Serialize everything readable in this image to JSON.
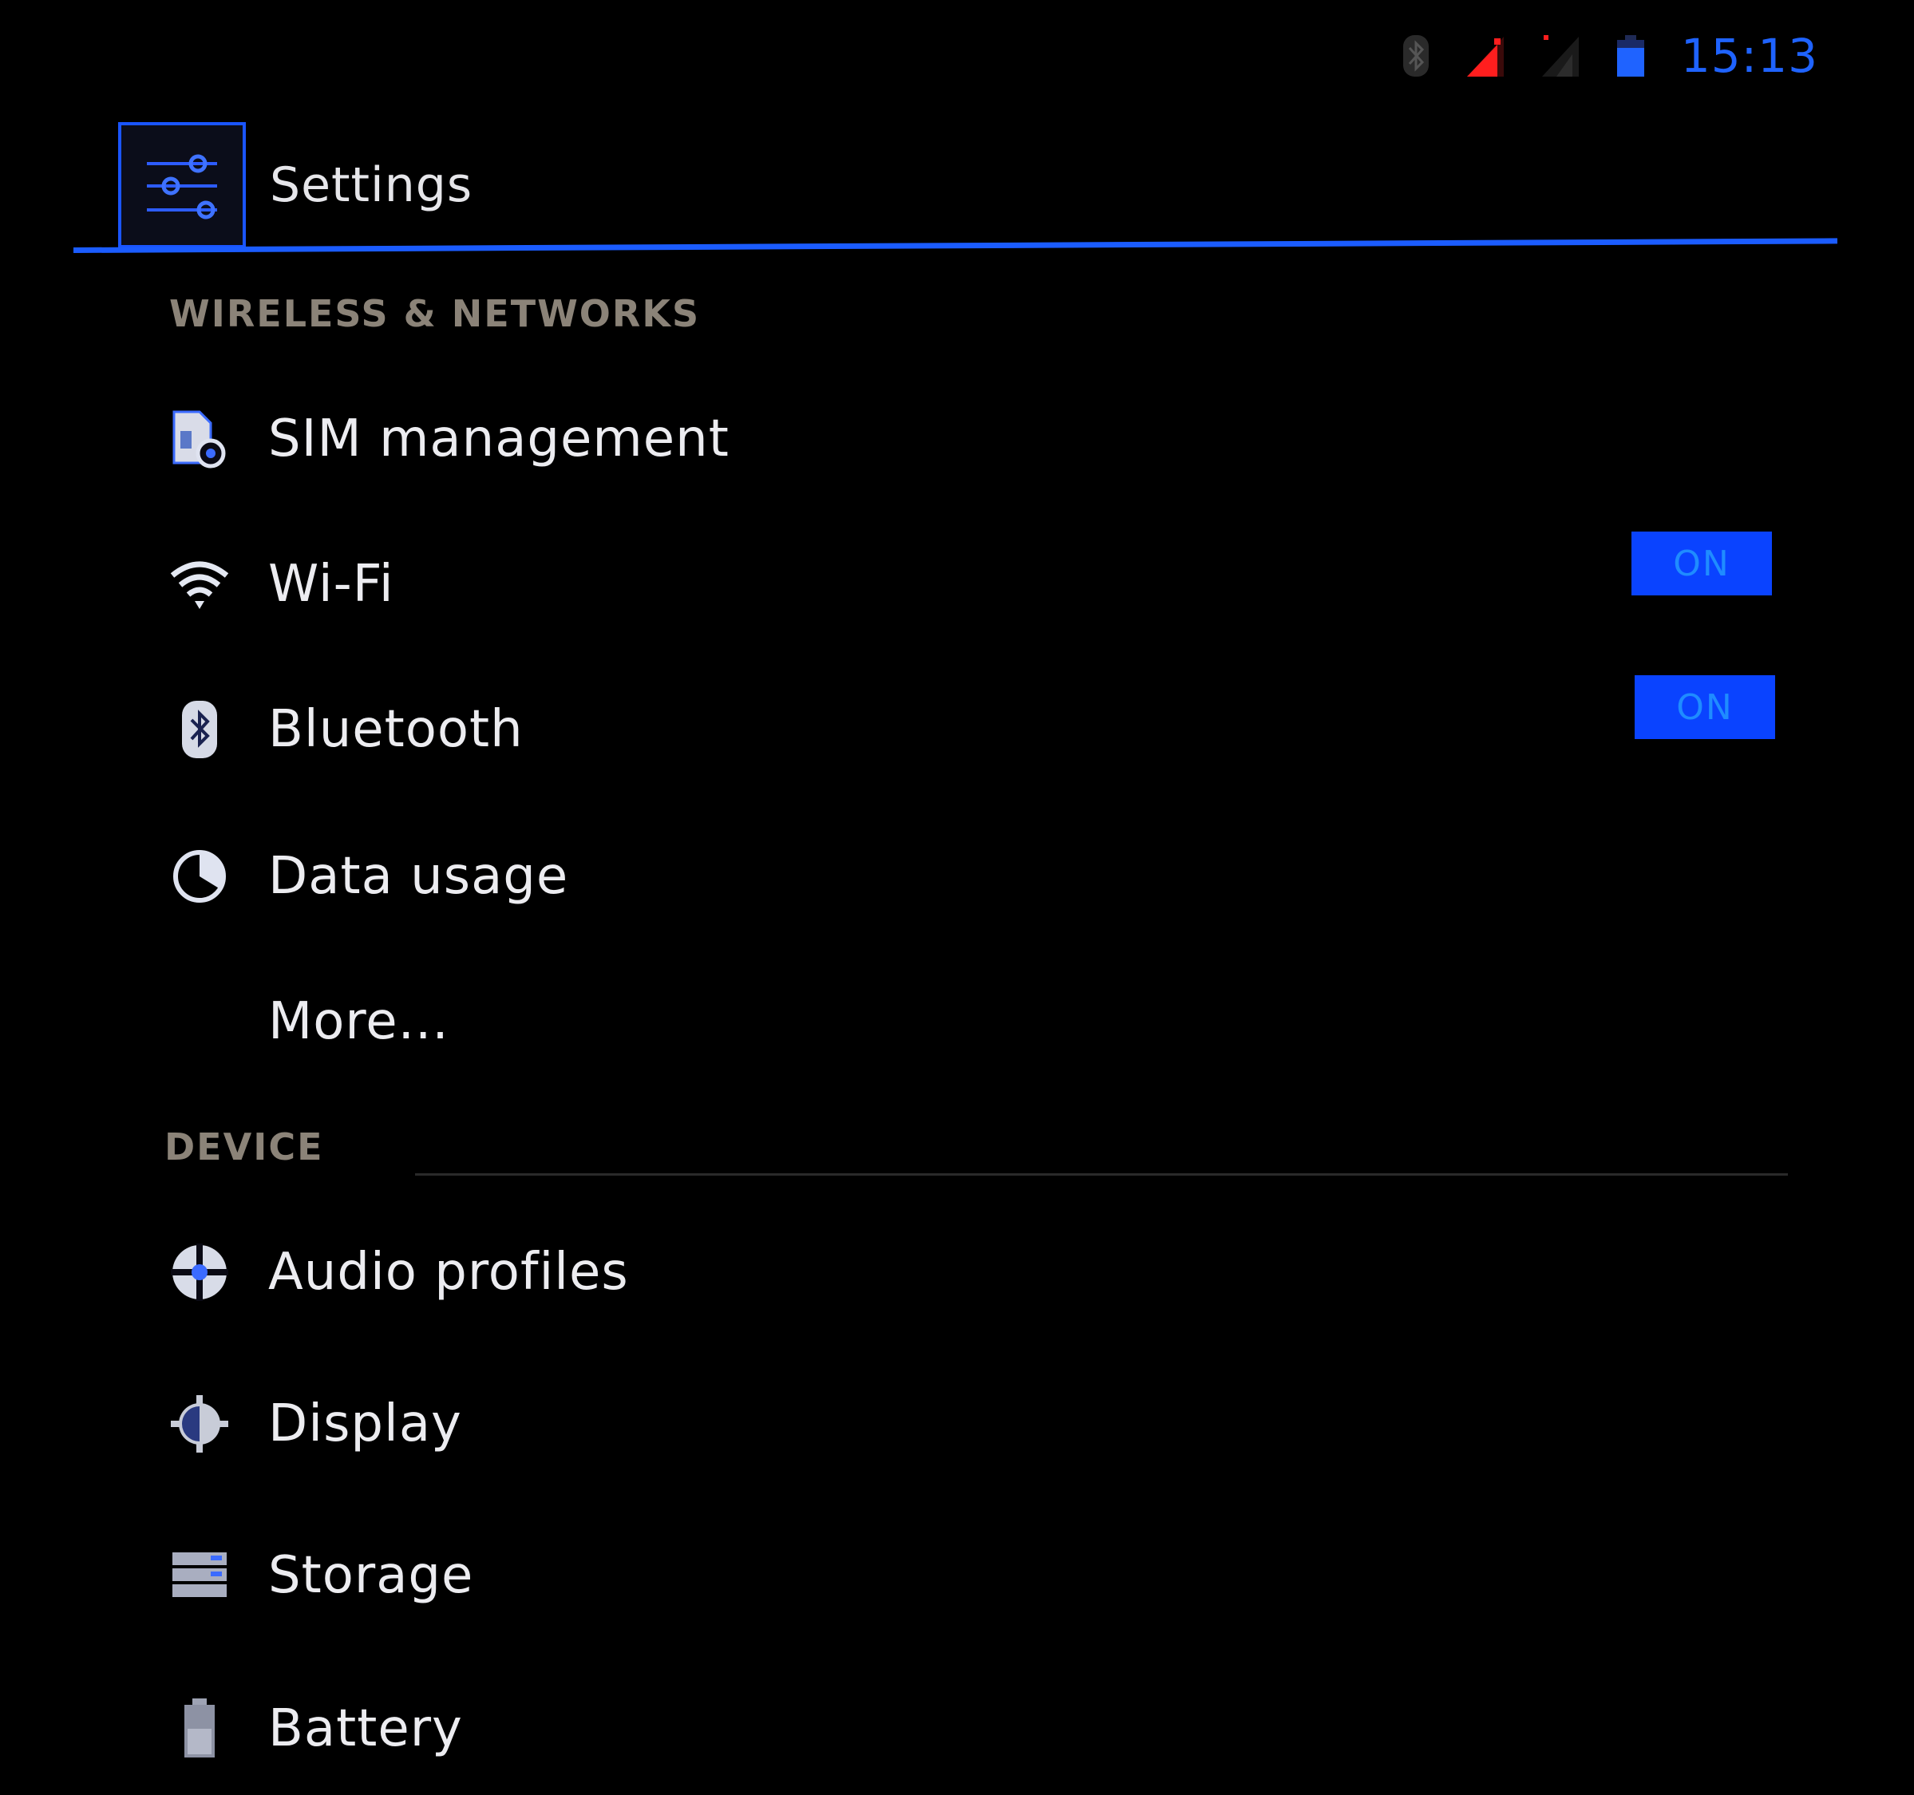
{
  "status_bar": {
    "time": "15:13",
    "icons": [
      "bluetooth-icon",
      "signal-sim1-icon",
      "signal-sim2-icon",
      "battery-icon"
    ],
    "colors": {
      "time": "#1f63ff",
      "signal_sim1": "#ff1e1e",
      "battery": "#1f63ff"
    }
  },
  "action_bar": {
    "title": "Settings",
    "icon": "settings-sliders-icon",
    "accent_color": "#1b5cff"
  },
  "sections": [
    {
      "header": "WIRELESS & NETWORKS",
      "items": [
        {
          "label": "SIM management",
          "icon": "sim-management-icon"
        },
        {
          "label": "Wi-Fi",
          "icon": "wifi-icon",
          "toggle": "ON"
        },
        {
          "label": "Bluetooth",
          "icon": "bluetooth-icon",
          "toggle": "ON"
        },
        {
          "label": "Data usage",
          "icon": "data-usage-icon"
        },
        {
          "label": "More...",
          "icon": ""
        }
      ]
    },
    {
      "header": "DEVICE",
      "items": [
        {
          "label": "Audio profiles",
          "icon": "audio-profiles-icon"
        },
        {
          "label": "Display",
          "icon": "display-icon"
        },
        {
          "label": "Storage",
          "icon": "storage-icon"
        },
        {
          "label": "Battery",
          "icon": "battery-icon"
        }
      ]
    }
  ]
}
